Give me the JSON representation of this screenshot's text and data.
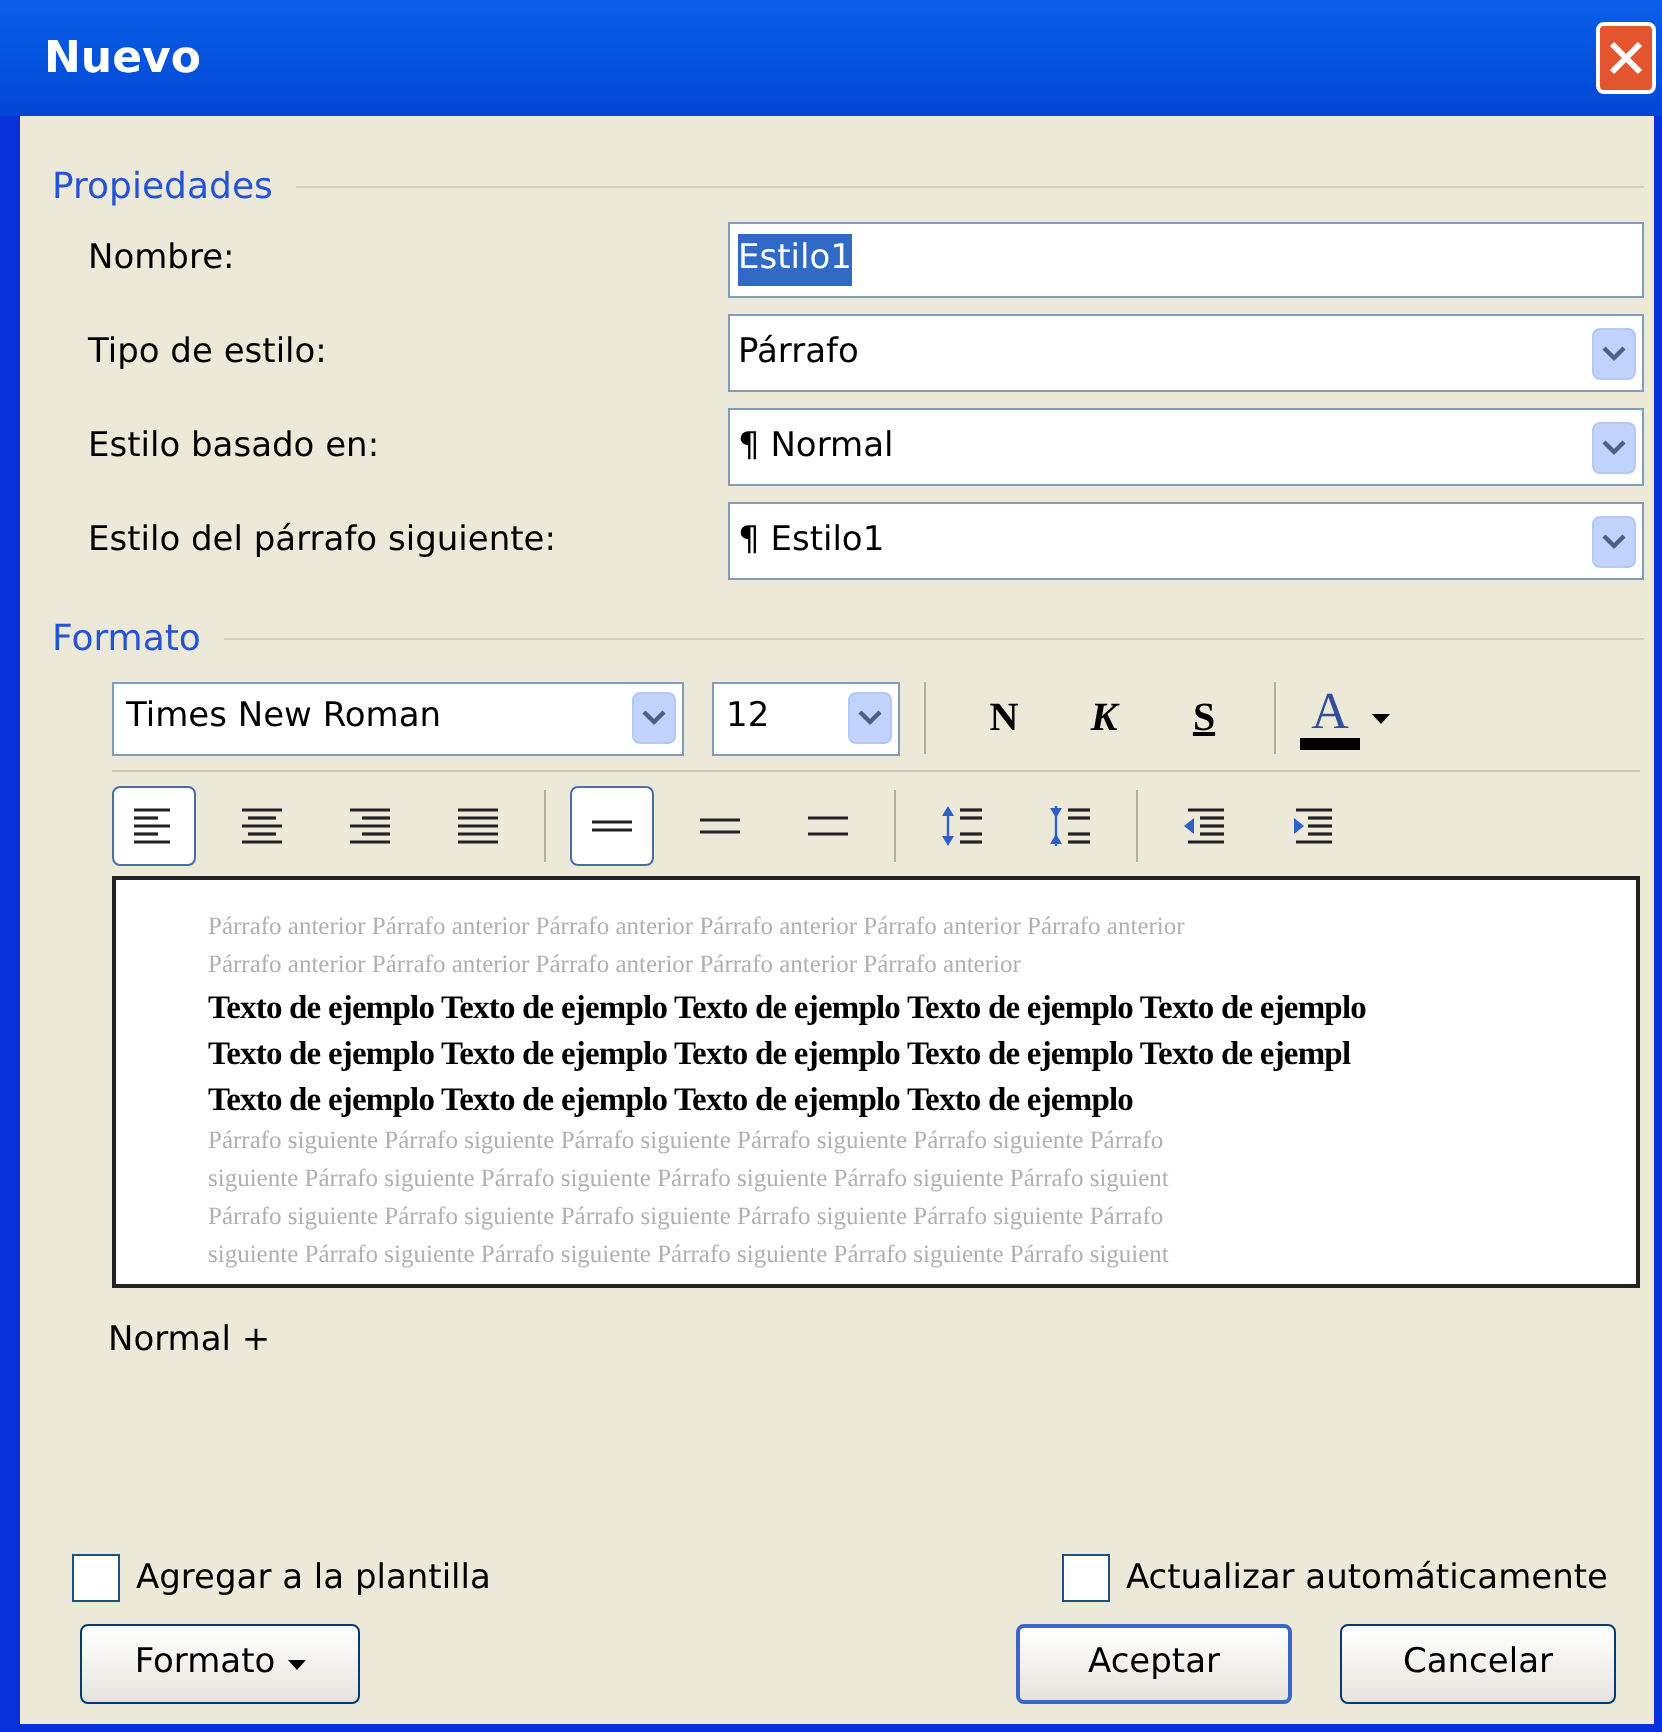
{
  "window": {
    "title": "Nuevo"
  },
  "properties": {
    "title": "Propiedades",
    "fields": [
      {
        "kind": "text",
        "label": "Nombre:",
        "value": "Estilo1"
      },
      {
        "kind": "select",
        "label": "Tipo de estilo:",
        "value": "Párrafo"
      },
      {
        "kind": "select",
        "label": "Estilo basado en:",
        "value": "¶ Normal"
      },
      {
        "kind": "select",
        "label": "Estilo del párrafo siguiente:",
        "value": "¶ Estilo1"
      }
    ]
  },
  "format": {
    "title": "Formato",
    "font": "Times New Roman",
    "size": "12",
    "style_buttons": [
      {
        "kind": "bold",
        "label": "N"
      },
      {
        "kind": "italic",
        "label": "K"
      },
      {
        "kind": "underline",
        "label": "S"
      }
    ],
    "color_button": {
      "label": "A"
    },
    "paragraph_buttons": [
      {
        "kind": "align-left",
        "selected": true
      },
      {
        "kind": "align-center",
        "selected": false
      },
      {
        "kind": "align-right",
        "selected": false
      },
      {
        "kind": "justify",
        "selected": false
      },
      {
        "kind": "single-spacing",
        "selected": true
      },
      {
        "kind": "one-half-spacing",
        "selected": false
      },
      {
        "kind": "double-spacing",
        "selected": false
      },
      {
        "kind": "space-before-more",
        "selected": false
      },
      {
        "kind": "space-before-less",
        "selected": false
      },
      {
        "kind": "decrease-indent",
        "selected": false
      },
      {
        "kind": "increase-indent",
        "selected": false
      }
    ]
  },
  "preview": {
    "lines": [
      {
        "kind": "previous",
        "text": "Párrafo anterior Párrafo anterior Párrafo anterior Párrafo anterior Párrafo anterior Párrafo anterior"
      },
      {
        "kind": "previous",
        "text": "Párrafo anterior Párrafo anterior Párrafo anterior Párrafo anterior Párrafo anterior"
      },
      {
        "kind": "sample",
        "text": "Texto de ejemplo Texto de ejemplo Texto de ejemplo Texto de ejemplo Texto de ejemplo"
      },
      {
        "kind": "sample",
        "text": "Texto de ejemplo Texto de ejemplo Texto de ejemplo Texto de ejemplo Texto de ejempl"
      },
      {
        "kind": "sample",
        "text": "Texto de ejemplo Texto de ejemplo Texto de ejemplo Texto de ejemplo"
      },
      {
        "kind": "next",
        "text": "Párrafo siguiente Párrafo siguiente Párrafo siguiente Párrafo siguiente Párrafo siguiente Párrafo"
      },
      {
        "kind": "next",
        "text": "siguiente Párrafo siguiente Párrafo siguiente Párrafo siguiente Párrafo siguiente Párrafo siguient"
      },
      {
        "kind": "next",
        "text": "Párrafo siguiente Párrafo siguiente Párrafo siguiente Párrafo siguiente Párrafo siguiente Párrafo"
      },
      {
        "kind": "next",
        "text": "siguiente Párrafo siguiente Párrafo siguiente Párrafo siguiente Párrafo siguiente Párrafo siguient"
      }
    ]
  },
  "description": "Normal +",
  "checkboxes": [
    {
      "label": "Agregar a la plantilla",
      "checked": false
    },
    {
      "label": "Actualizar automáticamente",
      "checked": false
    }
  ],
  "buttons": {
    "format": "Formato",
    "ok": "Aceptar",
    "cancel": "Cancelar"
  }
}
